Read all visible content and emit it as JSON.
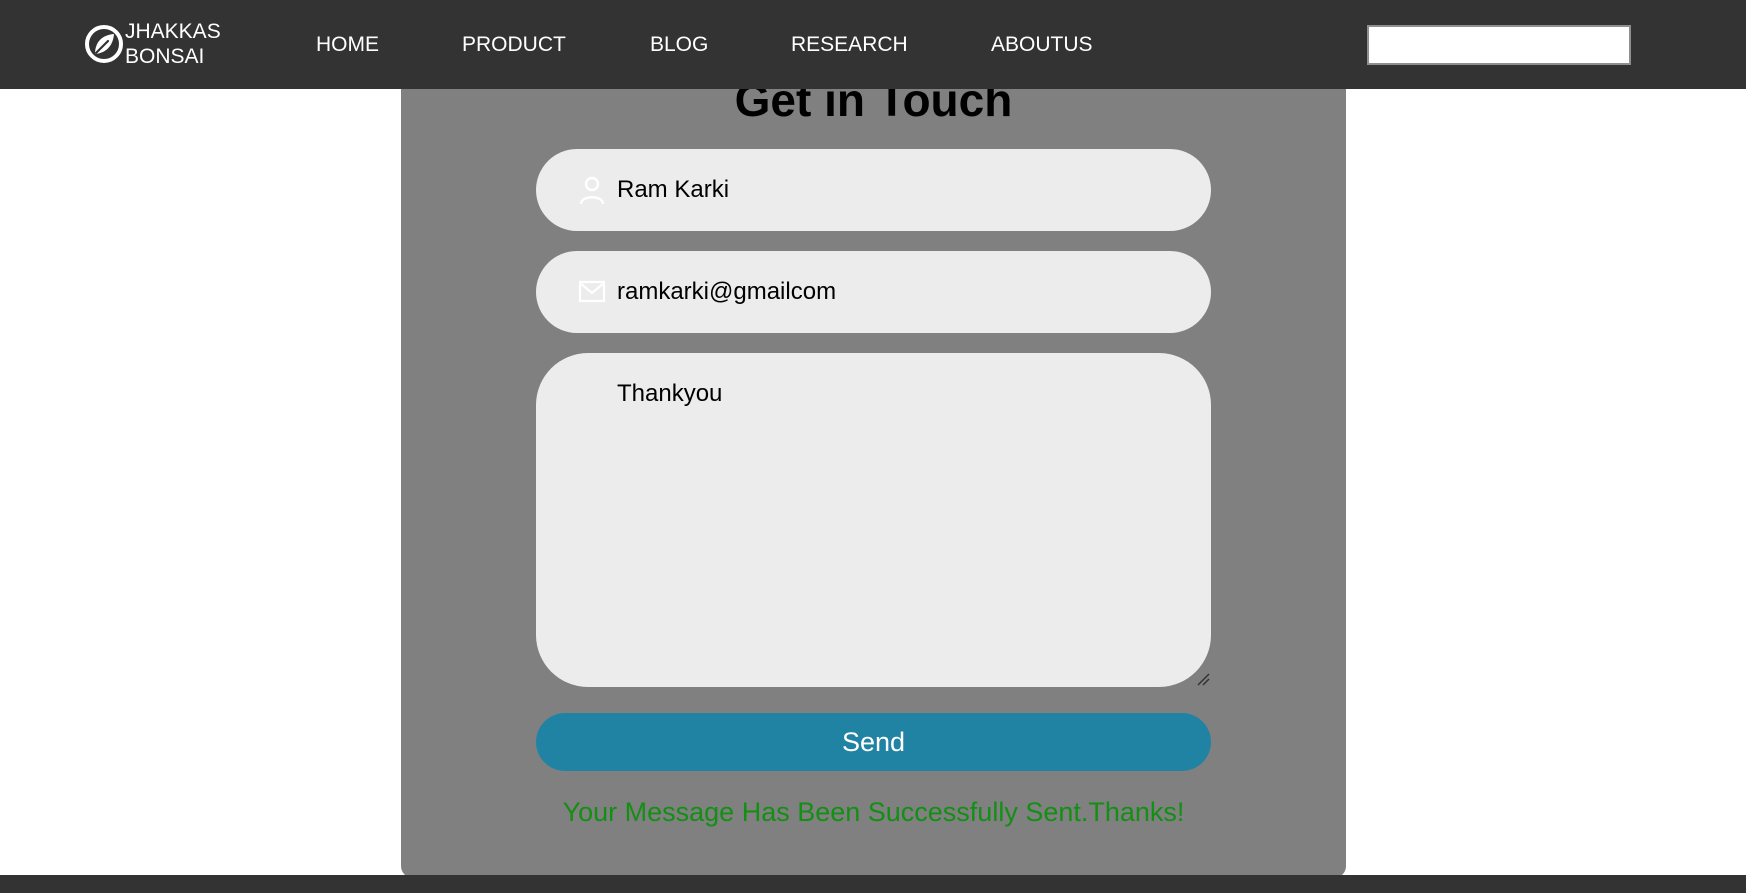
{
  "brand": {
    "line1": "JHAKKAS",
    "line2": "BONSAI",
    "icon": "leaf-icon"
  },
  "nav": {
    "home": "HOME",
    "product": "PRODUCT",
    "blog": "BLOG",
    "research": "RESEARCH",
    "about": "ABOUTUS"
  },
  "search": {
    "value": ""
  },
  "contact": {
    "heading": "Get in Touch",
    "name_value": "Ram Karki",
    "name_icon": "user-icon",
    "email_value": "ramkarki@gmailcom",
    "email_icon": "envelope-icon",
    "message_value": "Thankyou",
    "send_label": "Send",
    "success_message": "Your Message Has Been Successfully Sent.Thanks!"
  },
  "colors": {
    "navbar": "#333333",
    "panel": "#808080",
    "field": "#ececec",
    "send_button": "#2183a3",
    "success_text": "#138f13"
  }
}
